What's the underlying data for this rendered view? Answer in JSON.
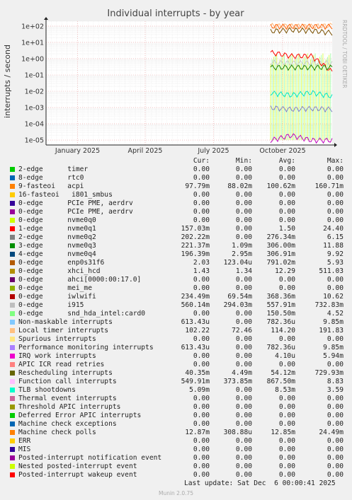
{
  "chart_data": {
    "type": "line",
    "title": "Individual interrupts - by year",
    "ylabel": "interrupts / second",
    "yscale": "log",
    "ylim": [
      5e-06,
      200
    ],
    "yticks": [
      "1e+02",
      "1e+01",
      "1e+00",
      "1e-01",
      "1e-02",
      "1e-03",
      "1e-04",
      "1e-05"
    ],
    "xticks": [
      "January 2025",
      "April 2025",
      "July 2025",
      "October 2025"
    ],
    "xrange": [
      "2024-11-20",
      "2025-12-06"
    ],
    "xtick_dates": [
      "2025-01-01",
      "2025-04-01",
      "2025-07-01",
      "2025-10-01"
    ],
    "data_start": "2025-09-15",
    "grid": true,
    "series_traces": [
      {
        "name": "Local timer interrupts",
        "color": "#ffb87a",
        "values": [
          110,
          105,
          100,
          114
        ]
      },
      {
        "name": "Rescheduling interrupts",
        "color": "#7a5000",
        "values": [
          50,
          60,
          54,
          40
        ]
      },
      {
        "name": "i915",
        "color": "#c8c8c8",
        "values": [
          0.6,
          0.55,
          0.56,
          0.56
        ]
      },
      {
        "name": "nvme0q1",
        "color": "#ff0000",
        "values": [
          2.5,
          1.5,
          1.5,
          0.16
        ]
      },
      {
        "name": "acpi",
        "color": "#ff6000",
        "values": [
          100,
          98,
          100,
          98
        ]
      },
      {
        "name": "TLB shootdowns",
        "color": "#00e6c8",
        "values": [
          0.008,
          0.006,
          0.0085,
          0.005
        ]
      },
      {
        "name": "nvme0q3",
        "color": "#208000",
        "values": [
          0.3,
          0.3,
          0.3,
          0.3
        ]
      },
      {
        "name": "Thermal event interrupts",
        "color": "#8080c8",
        "values": [
          0.001,
          0.0008,
          0.0009,
          0.0008
        ]
      },
      {
        "name": "Posted-interrupt notification event",
        "color": "#c000c0",
        "values": [
          1e-05,
          2e-05,
          1e-05,
          1e-05
        ]
      }
    ],
    "columns": [
      "Cur:",
      "Min:",
      "Avg:",
      "Max:"
    ],
    "legend": [
      {
        "color": "#00cc00",
        "label": "2-edge      timer",
        "cur": "0.00",
        "min": "0.00",
        "avg": "0.00",
        "max": "0.00"
      },
      {
        "color": "#0066b3",
        "label": "8-edge      rtc0",
        "cur": "0.00",
        "min": "0.00",
        "avg": "0.00",
        "max": "0.00"
      },
      {
        "color": "#ff8000",
        "label": "9-fasteoi   acpi",
        "cur": "97.79m",
        "min": "88.02m",
        "avg": "100.62m",
        "max": "160.71m"
      },
      {
        "color": "#ffcc00",
        "label": "16-fasteoi   i801_smbus",
        "cur": "0.00",
        "min": "0.00",
        "avg": "0.00",
        "max": "0.00"
      },
      {
        "color": "#330099",
        "label": "0-edge      PCIe PME, aerdrv",
        "cur": "0.00",
        "min": "0.00",
        "avg": "0.00",
        "max": "0.00"
      },
      {
        "color": "#990099",
        "label": "0-edge      PCIe PME, aerdrv",
        "cur": "0.00",
        "min": "0.00",
        "avg": "0.00",
        "max": "0.00"
      },
      {
        "color": "#ccff00",
        "label": "0-edge      nvme0q0",
        "cur": "0.00",
        "min": "0.00",
        "avg": "0.00",
        "max": "0.00"
      },
      {
        "color": "#ff0000",
        "label": "1-edge      nvme0q1",
        "cur": "157.03m",
        "min": "0.00",
        "avg": "1.50",
        "max": "24.40"
      },
      {
        "color": "#808080",
        "label": "2-edge      nvme0q2",
        "cur": "202.22m",
        "min": "0.00",
        "avg": "276.34m",
        "max": "6.15"
      },
      {
        "color": "#008f00",
        "label": "3-edge      nvme0q3",
        "cur": "221.37m",
        "min": "1.09m",
        "avg": "306.00m",
        "max": "11.88"
      },
      {
        "color": "#00487d",
        "label": "4-edge      nvme0q4",
        "cur": "196.39m",
        "min": "2.95m",
        "avg": "306.91m",
        "max": "9.92"
      },
      {
        "color": "#b35a00",
        "label": "0-edge      enp0s31f6",
        "cur": "2.03",
        "min": "123.04u",
        "avg": "791.02m",
        "max": "5.93"
      },
      {
        "color": "#b38f00",
        "label": "0-edge      xhci_hcd",
        "cur": "1.43",
        "min": "1.34",
        "avg": "12.29",
        "max": "511.03"
      },
      {
        "color": "#6b006b",
        "label": "0-edge      ahci[0000:00:17.0]",
        "cur": "0.00",
        "min": "0.00",
        "avg": "0.00",
        "max": "0.00"
      },
      {
        "color": "#8fb300",
        "label": "0-edge      mei_me",
        "cur": "0.00",
        "min": "0.00",
        "avg": "0.00",
        "max": "0.00"
      },
      {
        "color": "#b30000",
        "label": "0-edge      iwlwifi",
        "cur": "234.49m",
        "min": "69.54m",
        "avg": "368.36m",
        "max": "10.62"
      },
      {
        "color": "#bebebe",
        "label": "0-edge      i915",
        "cur": "560.14m",
        "min": "294.03m",
        "avg": "557.91m",
        "max": "732.83m"
      },
      {
        "color": "#80ff80",
        "label": "0-edge      snd_hda_intel:card0",
        "cur": "0.00",
        "min": "0.00",
        "avg": "150.50m",
        "max": "4.52"
      },
      {
        "color": "#80c9ff",
        "label": "Non-maskable interrupts",
        "cur": "613.43u",
        "min": "0.00",
        "avg": "782.36u",
        "max": "9.85m"
      },
      {
        "color": "#ffc080",
        "label": "Local timer interrupts",
        "cur": "102.22",
        "min": "72.46",
        "avg": "114.20",
        "max": "191.83"
      },
      {
        "color": "#ffe680",
        "label": "Spurious interrupts",
        "cur": "0.00",
        "min": "0.00",
        "avg": "0.00",
        "max": "0.00"
      },
      {
        "color": "#aa80ff",
        "label": "Performance monitoring interrupts",
        "cur": "613.43u",
        "min": "0.00",
        "avg": "782.36u",
        "max": "9.85m"
      },
      {
        "color": "#ee00cc",
        "label": "IRQ work interrupts",
        "cur": "0.00",
        "min": "0.00",
        "avg": "4.10u",
        "max": "5.94m"
      },
      {
        "color": "#ff8080",
        "label": "APIC ICR read retries",
        "cur": "0.00",
        "min": "0.00",
        "avg": "0.00",
        "max": "0.00"
      },
      {
        "color": "#666600",
        "label": "Rescheduling interrupts",
        "cur": "40.35m",
        "min": "4.49m",
        "avg": "54.12m",
        "max": "729.93m"
      },
      {
        "color": "#ffbfff",
        "label": "Function call interrupts",
        "cur": "549.91m",
        "min": "373.85m",
        "avg": "867.50m",
        "max": "8.83"
      },
      {
        "color": "#00ffcc",
        "label": "TLB shootdowns",
        "cur": "5.09m",
        "min": "0.00",
        "avg": "8.53m",
        "max": "3.59"
      },
      {
        "color": "#cc6699",
        "label": "Thermal event interrupts",
        "cur": "0.00",
        "min": "0.00",
        "avg": "0.00",
        "max": "0.00"
      },
      {
        "color": "#999900",
        "label": "Threshold APIC interrupts",
        "cur": "0.00",
        "min": "0.00",
        "avg": "0.00",
        "max": "0.00"
      },
      {
        "color": "#00cc00",
        "label": "Deferred Error APIC interrupts",
        "cur": "0.00",
        "min": "0.00",
        "avg": "0.00",
        "max": "0.00"
      },
      {
        "color": "#0066b3",
        "label": "Machine check exceptions",
        "cur": "0.00",
        "min": "0.00",
        "avg": "0.00",
        "max": "0.00"
      },
      {
        "color": "#ff8000",
        "label": "Machine check polls",
        "cur": "12.87m",
        "min": "308.88u",
        "avg": "12.85m",
        "max": "24.49m"
      },
      {
        "color": "#ffcc00",
        "label": "ERR",
        "cur": "0.00",
        "min": "0.00",
        "avg": "0.00",
        "max": "0.00"
      },
      {
        "color": "#330099",
        "label": "MIS",
        "cur": "0.00",
        "min": "0.00",
        "avg": "0.00",
        "max": "0.00"
      },
      {
        "color": "#990099",
        "label": "Posted-interrupt notification event",
        "cur": "0.00",
        "min": "0.00",
        "avg": "0.00",
        "max": "0.00"
      },
      {
        "color": "#ccff00",
        "label": "Nested posted-interrupt event",
        "cur": "0.00",
        "min": "0.00",
        "avg": "0.00",
        "max": "0.00"
      },
      {
        "color": "#ff0000",
        "label": "Posted-interrupt wakeup event",
        "cur": "0.00",
        "min": "0.00",
        "avg": "0.00",
        "max": "0.00"
      }
    ]
  },
  "watermark": "RRDTOOL / TOBI OETIKER",
  "last_update": "Last update: Sat Dec  6 00:00:41 2025",
  "footer": "Munin 2.0.75"
}
